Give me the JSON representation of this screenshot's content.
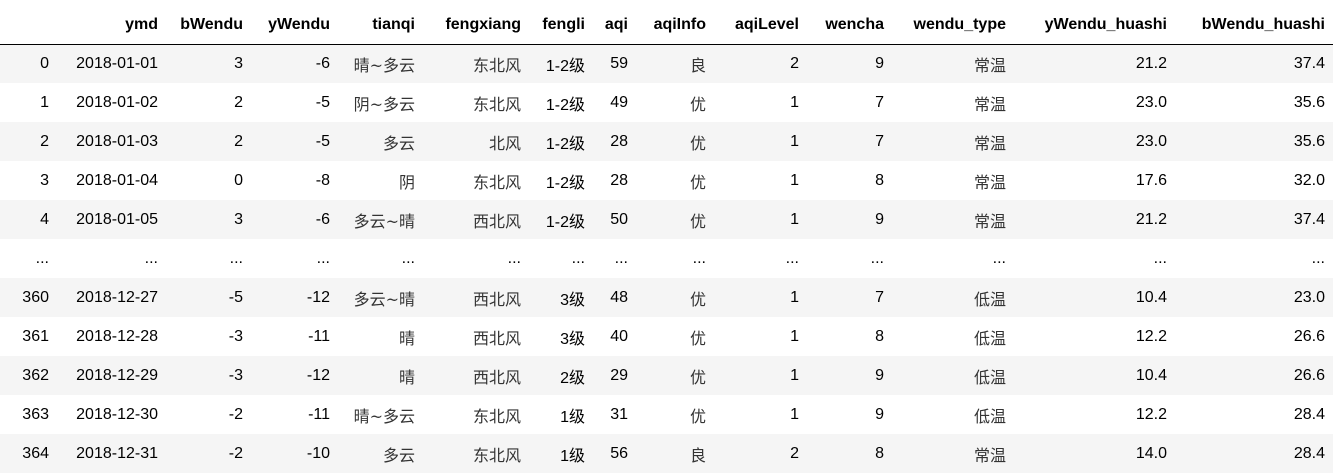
{
  "table": {
    "index_header": "",
    "columns": [
      "ymd",
      "bWendu",
      "yWendu",
      "tianqi",
      "fengxiang",
      "fengli",
      "aqi",
      "aqiInfo",
      "aqiLevel",
      "wencha",
      "wendu_type",
      "yWendu_huashi",
      "bWendu_huashi"
    ],
    "rows": [
      {
        "index": "0",
        "cells": [
          "2018-01-01",
          "3",
          "-6",
          "晴~多云",
          "东北风",
          "1-2级",
          "59",
          "良",
          "2",
          "9",
          "常温",
          "21.2",
          "37.4"
        ]
      },
      {
        "index": "1",
        "cells": [
          "2018-01-02",
          "2",
          "-5",
          "阴~多云",
          "东北风",
          "1-2级",
          "49",
          "优",
          "1",
          "7",
          "常温",
          "23.0",
          "35.6"
        ]
      },
      {
        "index": "2",
        "cells": [
          "2018-01-03",
          "2",
          "-5",
          "多云",
          "北风",
          "1-2级",
          "28",
          "优",
          "1",
          "7",
          "常温",
          "23.0",
          "35.6"
        ]
      },
      {
        "index": "3",
        "cells": [
          "2018-01-04",
          "0",
          "-8",
          "阴",
          "东北风",
          "1-2级",
          "28",
          "优",
          "1",
          "8",
          "常温",
          "17.6",
          "32.0"
        ]
      },
      {
        "index": "4",
        "cells": [
          "2018-01-05",
          "3",
          "-6",
          "多云~晴",
          "西北风",
          "1-2级",
          "50",
          "优",
          "1",
          "9",
          "常温",
          "21.2",
          "37.4"
        ]
      },
      {
        "index": "...",
        "cells": [
          "...",
          "...",
          "...",
          "...",
          "...",
          "...",
          "...",
          "...",
          "...",
          "...",
          "...",
          "...",
          "..."
        ]
      },
      {
        "index": "360",
        "cells": [
          "2018-12-27",
          "-5",
          "-12",
          "多云~晴",
          "西北风",
          "3级",
          "48",
          "优",
          "1",
          "7",
          "低温",
          "10.4",
          "23.0"
        ]
      },
      {
        "index": "361",
        "cells": [
          "2018-12-28",
          "-3",
          "-11",
          "晴",
          "西北风",
          "3级",
          "40",
          "优",
          "1",
          "8",
          "低温",
          "12.2",
          "26.6"
        ]
      },
      {
        "index": "362",
        "cells": [
          "2018-12-29",
          "-3",
          "-12",
          "晴",
          "西北风",
          "2级",
          "29",
          "优",
          "1",
          "9",
          "低温",
          "10.4",
          "26.6"
        ]
      },
      {
        "index": "363",
        "cells": [
          "2018-12-30",
          "-2",
          "-11",
          "晴~多云",
          "东北风",
          "1级",
          "31",
          "优",
          "1",
          "9",
          "低温",
          "12.2",
          "28.4"
        ]
      },
      {
        "index": "364",
        "cells": [
          "2018-12-31",
          "-2",
          "-10",
          "多云",
          "东北风",
          "1级",
          "56",
          "良",
          "2",
          "8",
          "常温",
          "14.0",
          "28.4"
        ]
      }
    ]
  }
}
